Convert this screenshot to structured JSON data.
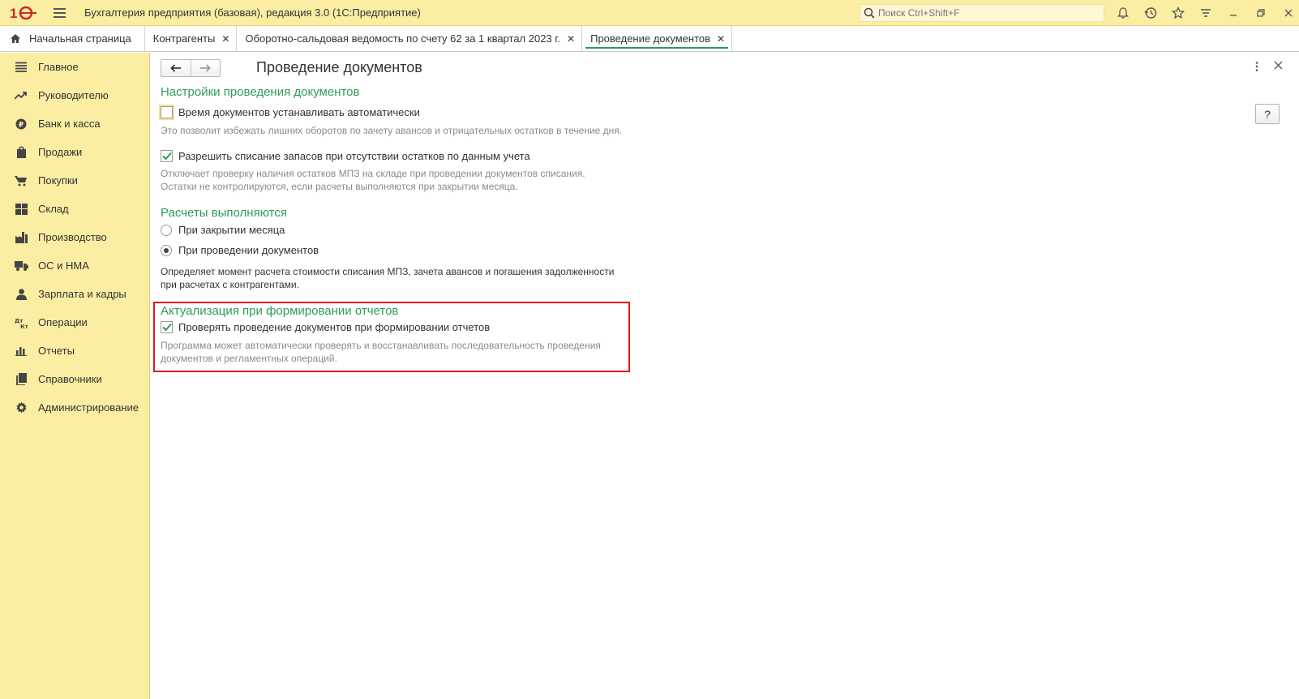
{
  "app": {
    "title": "Бухгалтерия предприятия (базовая), редакция 3.0  (1С:Предприятие)",
    "search_placeholder": "Поиск Ctrl+Shift+F"
  },
  "tabs": [
    {
      "label": "Начальная страница"
    },
    {
      "label": "Контрагенты"
    },
    {
      "label": "Оборотно-сальдовая ведомость по счету 62 за 1 квартал 2023 г."
    },
    {
      "label": "Проведение документов"
    }
  ],
  "sidebar": {
    "items": [
      {
        "label": "Главное",
        "icon": "list-icon"
      },
      {
        "label": "Руководителю",
        "icon": "trend-icon"
      },
      {
        "label": "Банк и касса",
        "icon": "coin-icon"
      },
      {
        "label": "Продажи",
        "icon": "bag-icon"
      },
      {
        "label": "Покупки",
        "icon": "cart-icon"
      },
      {
        "label": "Склад",
        "icon": "warehouse-icon"
      },
      {
        "label": "Производство",
        "icon": "factory-icon"
      },
      {
        "label": "ОС и НМА",
        "icon": "truck-icon"
      },
      {
        "label": "Зарплата и кадры",
        "icon": "person-icon"
      },
      {
        "label": "Операции",
        "icon": "dt-kt-icon"
      },
      {
        "label": "Отчеты",
        "icon": "bar-chart-icon"
      },
      {
        "label": "Справочники",
        "icon": "books-icon"
      },
      {
        "label": "Администрирование",
        "icon": "gear-icon"
      }
    ]
  },
  "page": {
    "title": "Проведение документов",
    "help_label": "?",
    "section1": {
      "title": "Настройки проведения документов",
      "auto_time_label": "Время документов устанавливать автоматически",
      "auto_time_checked": false,
      "auto_time_hint": "Это позволит избежать лишних оборотов по зачету авансов и отрицательных остатков в течение дня.",
      "allow_writeoff_label": "Разрешить списание запасов при отсутствии остатков по данным учета",
      "allow_writeoff_checked": true,
      "allow_writeoff_hint1": "Отключает проверку наличия остатков МПЗ на складе при проведении документов списания.",
      "allow_writeoff_hint2": "Остатки не контролируются, если расчеты выполняются при закрытии месяца."
    },
    "section2": {
      "title": "Расчеты выполняются",
      "option1": "При закрытии месяца",
      "option2": "При проведении документов",
      "selected": "option2",
      "note1": "Определяет момент расчета стоимости списания МПЗ, зачета авансов и погашения задолженности",
      "note2": "при расчетах с контрагентами."
    },
    "section3": {
      "title": "Актуализация при формировании отчетов",
      "check_label": "Проверять проведение документов при формировании отчетов",
      "check_checked": true,
      "hint1": "Программа может автоматически проверять и восстанавливать последовательность проведения",
      "hint2": "документов и регламентных операций."
    }
  },
  "colors": {
    "accent_green": "#2d9b58",
    "panel_yellow": "#fbeda2",
    "highlight_red": "#e3141e"
  }
}
